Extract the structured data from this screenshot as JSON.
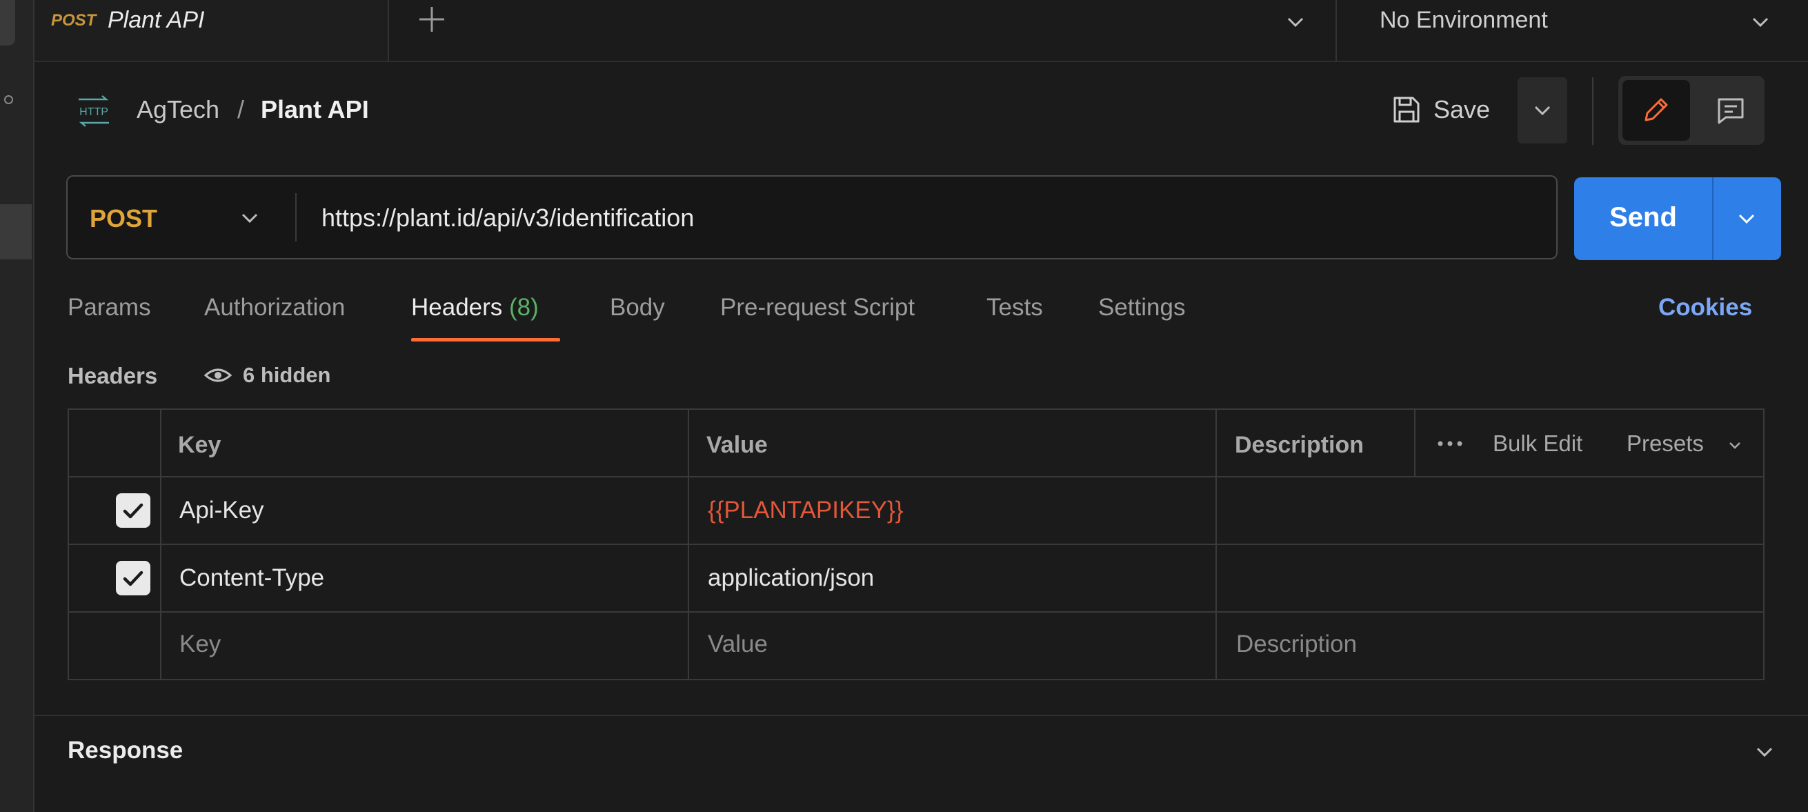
{
  "tab": {
    "method": "POST",
    "title": "Plant API"
  },
  "environment": {
    "label": "No Environment"
  },
  "breadcrumb": {
    "icon_text": "HTTP",
    "collection": "AgTech",
    "separator": "/",
    "request": "Plant API"
  },
  "toolbar": {
    "save_label": "Save"
  },
  "request": {
    "method": "POST",
    "url": "https://plant.id/api/v3/identification",
    "send_label": "Send"
  },
  "request_tabs": [
    {
      "label": "Params"
    },
    {
      "label": "Authorization"
    },
    {
      "label": "Headers",
      "count": "(8)"
    },
    {
      "label": "Body"
    },
    {
      "label": "Pre-request Script"
    },
    {
      "label": "Tests"
    },
    {
      "label": "Settings"
    }
  ],
  "cookies_label": "Cookies",
  "headers_section": {
    "title": "Headers",
    "hidden_label": "6 hidden"
  },
  "table": {
    "columns": {
      "key": "Key",
      "value": "Value",
      "description": "Description"
    },
    "actions": {
      "bulk_edit": "Bulk Edit",
      "presets": "Presets"
    },
    "rows": [
      {
        "checked": true,
        "key": "Api-Key",
        "value": "{{PLANTAPIKEY}}",
        "description": ""
      },
      {
        "checked": true,
        "key": "Content-Type",
        "value": "application/json",
        "description": ""
      }
    ],
    "placeholders": {
      "key": "Key",
      "value": "Value",
      "description": "Description"
    }
  },
  "response": {
    "label": "Response"
  },
  "colors": {
    "accent_orange": "#ff6c37",
    "method_post": "#e0a53a",
    "send_blue": "#2f7fe8",
    "variable_red": "#e2573a",
    "count_green": "#5ab267",
    "link_blue": "#7ba7f5"
  },
  "icons": [
    "http-icon",
    "save-icon",
    "chevron-down-icon",
    "edit-icon",
    "comment-icon",
    "plus-icon",
    "eye-icon",
    "more-icon",
    "check-icon"
  ]
}
